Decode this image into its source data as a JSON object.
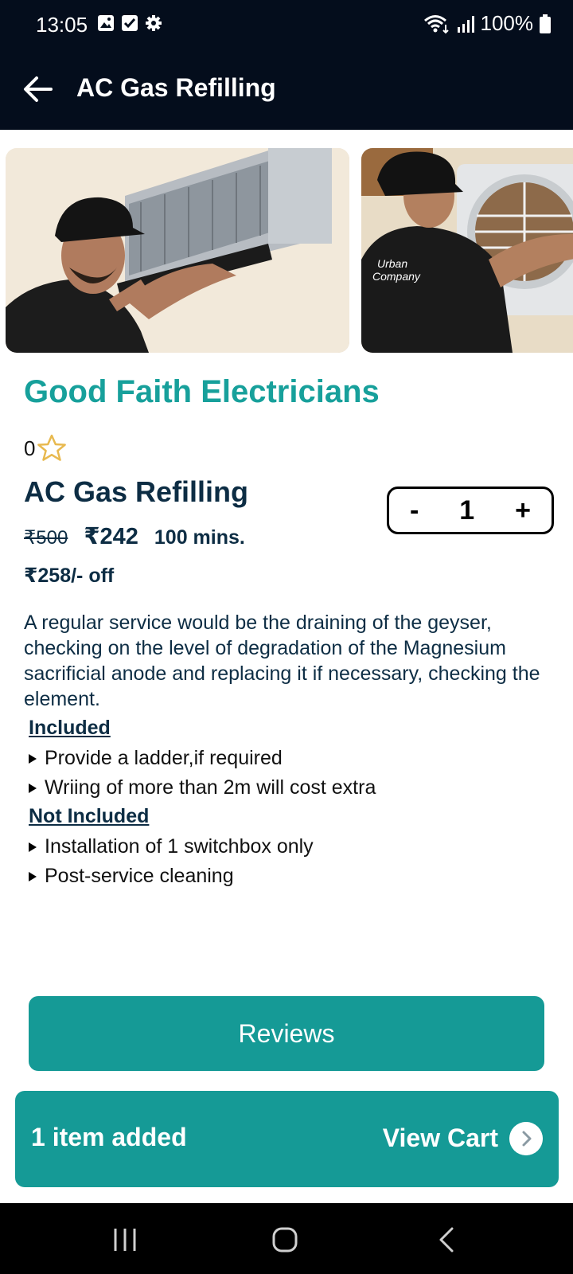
{
  "status_bar": {
    "time": "13:05",
    "battery": "100%",
    "icons": [
      "gallery-icon",
      "checkbox-icon",
      "settings-icon",
      "wifi-icon",
      "signal-icon",
      "battery-icon"
    ]
  },
  "app_bar": {
    "title": "AC Gas Refilling",
    "back_icon": "arrow-left-icon"
  },
  "photos": [
    "technician-servicing-indoor-ac-photo",
    "technician-servicing-outdoor-ac-photo"
  ],
  "provider": {
    "name": "Good Faith Electricians",
    "rating": "0",
    "rating_icon": "star-outline-icon"
  },
  "service": {
    "name": "AC Gas Refilling",
    "old_price": "₹500",
    "new_price": "₹242",
    "duration": "100 mins.",
    "discount": "₹258/- off",
    "description": "A regular service would be the draining of the geyser, checking on the level of degradation of the Magnesium sacrificial anode and replacing it if necessary, checking the element."
  },
  "stepper": {
    "minus": "-",
    "quantity": "1",
    "plus": "+"
  },
  "included": {
    "title": "Included",
    "items": [
      "Provide a ladder,if required",
      "Wriing of more than 2m will cost extra"
    ]
  },
  "not_included": {
    "title": "Not Included",
    "items": [
      "Installation of 1 switchbox only",
      "Post-service cleaning"
    ]
  },
  "reviews_button": "Reviews",
  "cart": {
    "count_label": "1 item added",
    "view_label": "View Cart",
    "arrow_icon": "chevron-right-icon"
  },
  "colors": {
    "accent": "#159a96",
    "header": "#040d1c",
    "text_dark": "#0d2d44"
  }
}
